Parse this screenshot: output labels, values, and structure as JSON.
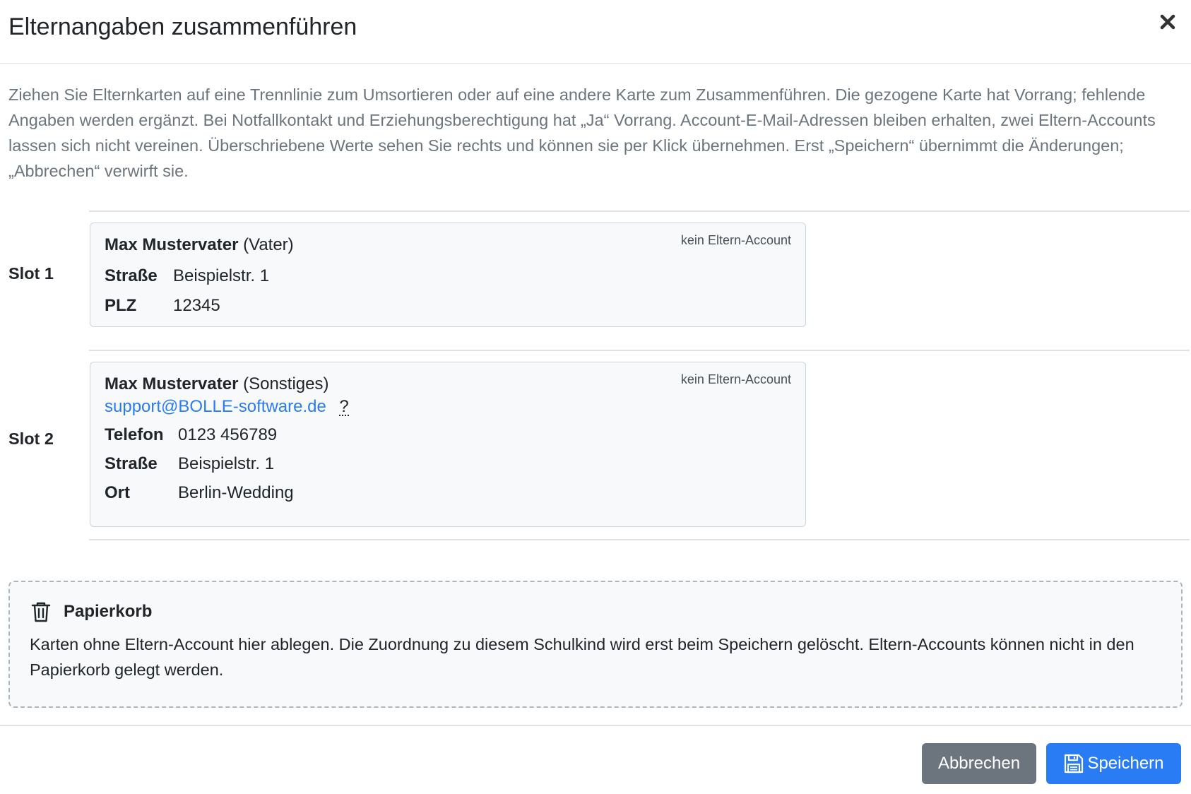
{
  "modal": {
    "title": "Elternangaben zusammenführen",
    "intro": "Ziehen Sie Elternkarten auf eine Trennlinie zum Umsortieren oder auf eine andere Karte zum Zusammenführen. Die gezogene Karte hat Vorrang; fehlende Angaben werden ergänzt. Bei Notfallkontakt und Erziehungsberechtigung hat „Ja“ Vorrang. Account-E-Mail-Adressen bleiben erhalten, zwei Eltern-Accounts lassen sich nicht vereinen. Überschriebene Werte sehen Sie rechts und können sie per Klick übernehmen. Erst „Speichern“ übernimmt die Änderungen; „Abbrechen“ verwirft sie."
  },
  "slots": [
    {
      "label": "Slot 1",
      "card": {
        "name": "Max Mustervater",
        "role": "(Vater)",
        "account": "kein Eltern-Account",
        "fields": [
          {
            "key": "Straße",
            "value": "Beispielstr. 1"
          },
          {
            "key": "PLZ",
            "value": "12345"
          }
        ]
      }
    },
    {
      "label": "Slot 2",
      "card": {
        "name": "Max Mustervater",
        "role": "(Sonstiges)",
        "account": "kein Eltern-Account",
        "email": "support@BOLLE-software.de",
        "help": "?",
        "fields": [
          {
            "key": "Telefon",
            "value": "0123 456789"
          },
          {
            "key": "Straße",
            "value": "Beispielstr. 1"
          },
          {
            "key": "Ort",
            "value": "Berlin-Wedding"
          }
        ]
      }
    }
  ],
  "trash": {
    "icon": "trash-icon",
    "title": "Papierkorb",
    "text": "Karten ohne Eltern-Account hier ablegen. Die Zuordnung zu diesem Schulkind wird erst beim Speichern gelöscht. Eltern-Accounts können nicht in den Papierkorb gelegt werden."
  },
  "footer": {
    "cancel_label": "Abbrechen",
    "save_label": "Speichern",
    "save_icon": "save-icon"
  },
  "colors": {
    "primary": "#2a7cf4",
    "secondary": "#6c757d",
    "muted_text": "#6c757d"
  }
}
